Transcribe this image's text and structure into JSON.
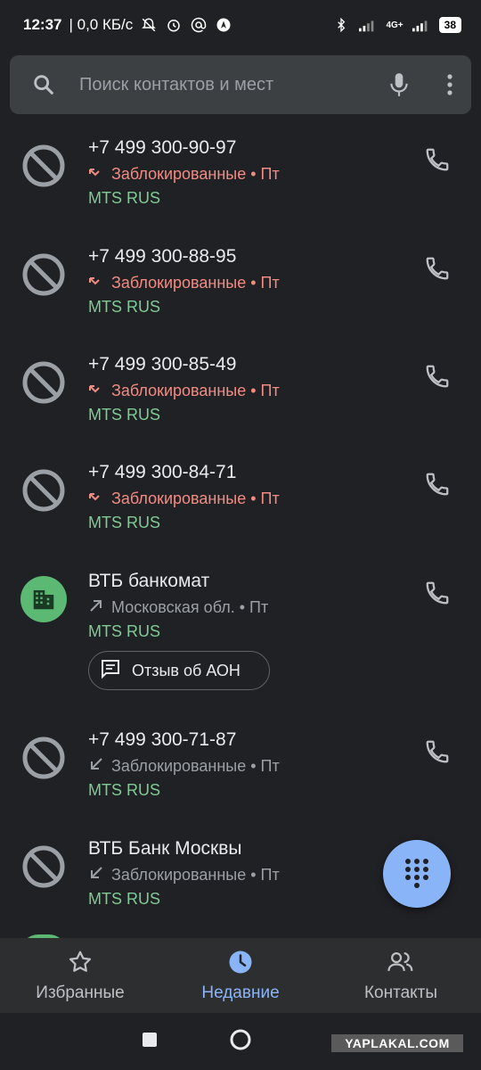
{
  "status_bar": {
    "time": "12:37",
    "speed": "| 0,0 КБ/с",
    "network": "4G+",
    "battery": "38"
  },
  "search": {
    "placeholder": "Поиск контактов и мест"
  },
  "calls": [
    {
      "title": "+7 499 300-90-97",
      "subtitle": "Заблокированные • Пт",
      "carrier": "MTS RUS",
      "type": "blocked",
      "direction": "missed"
    },
    {
      "title": "+7 499 300-88-95",
      "subtitle": "Заблокированные • Пт",
      "carrier": "MTS RUS",
      "type": "blocked",
      "direction": "missed"
    },
    {
      "title": "+7 499 300-85-49",
      "subtitle": "Заблокированные • Пт",
      "carrier": "MTS RUS",
      "type": "blocked",
      "direction": "missed"
    },
    {
      "title": "+7 499 300-84-71",
      "subtitle": "Заблокированные • Пт",
      "carrier": "MTS RUS",
      "type": "blocked",
      "direction": "missed"
    },
    {
      "title": "ВТБ банкомат",
      "subtitle": "Московская обл. • Пт",
      "carrier": "MTS RUS",
      "type": "business",
      "direction": "outgoing"
    },
    {
      "title": "+7 499 300-71-87",
      "subtitle": "Заблокированные • Пт",
      "carrier": "MTS RUS",
      "type": "blocked",
      "direction": "incoming"
    },
    {
      "title": "ВТБ Банк Москвы",
      "subtitle": "Заблокированные • Пт",
      "carrier": "MTS RUS",
      "type": "blocked",
      "direction": "incoming"
    }
  ],
  "feedback_chip": {
    "label": "Отзыв об АОН"
  },
  "bottom_nav": {
    "favorites": "Избранные",
    "recents": "Недавние",
    "contacts": "Контакты"
  },
  "watermark": "YAPLAKAL.COM",
  "colors": {
    "background": "#202124",
    "blocked_text": "#f28b82",
    "carrier_text": "#81c995",
    "accent": "#8ab4f8",
    "business_avatar": "#5bb974"
  }
}
